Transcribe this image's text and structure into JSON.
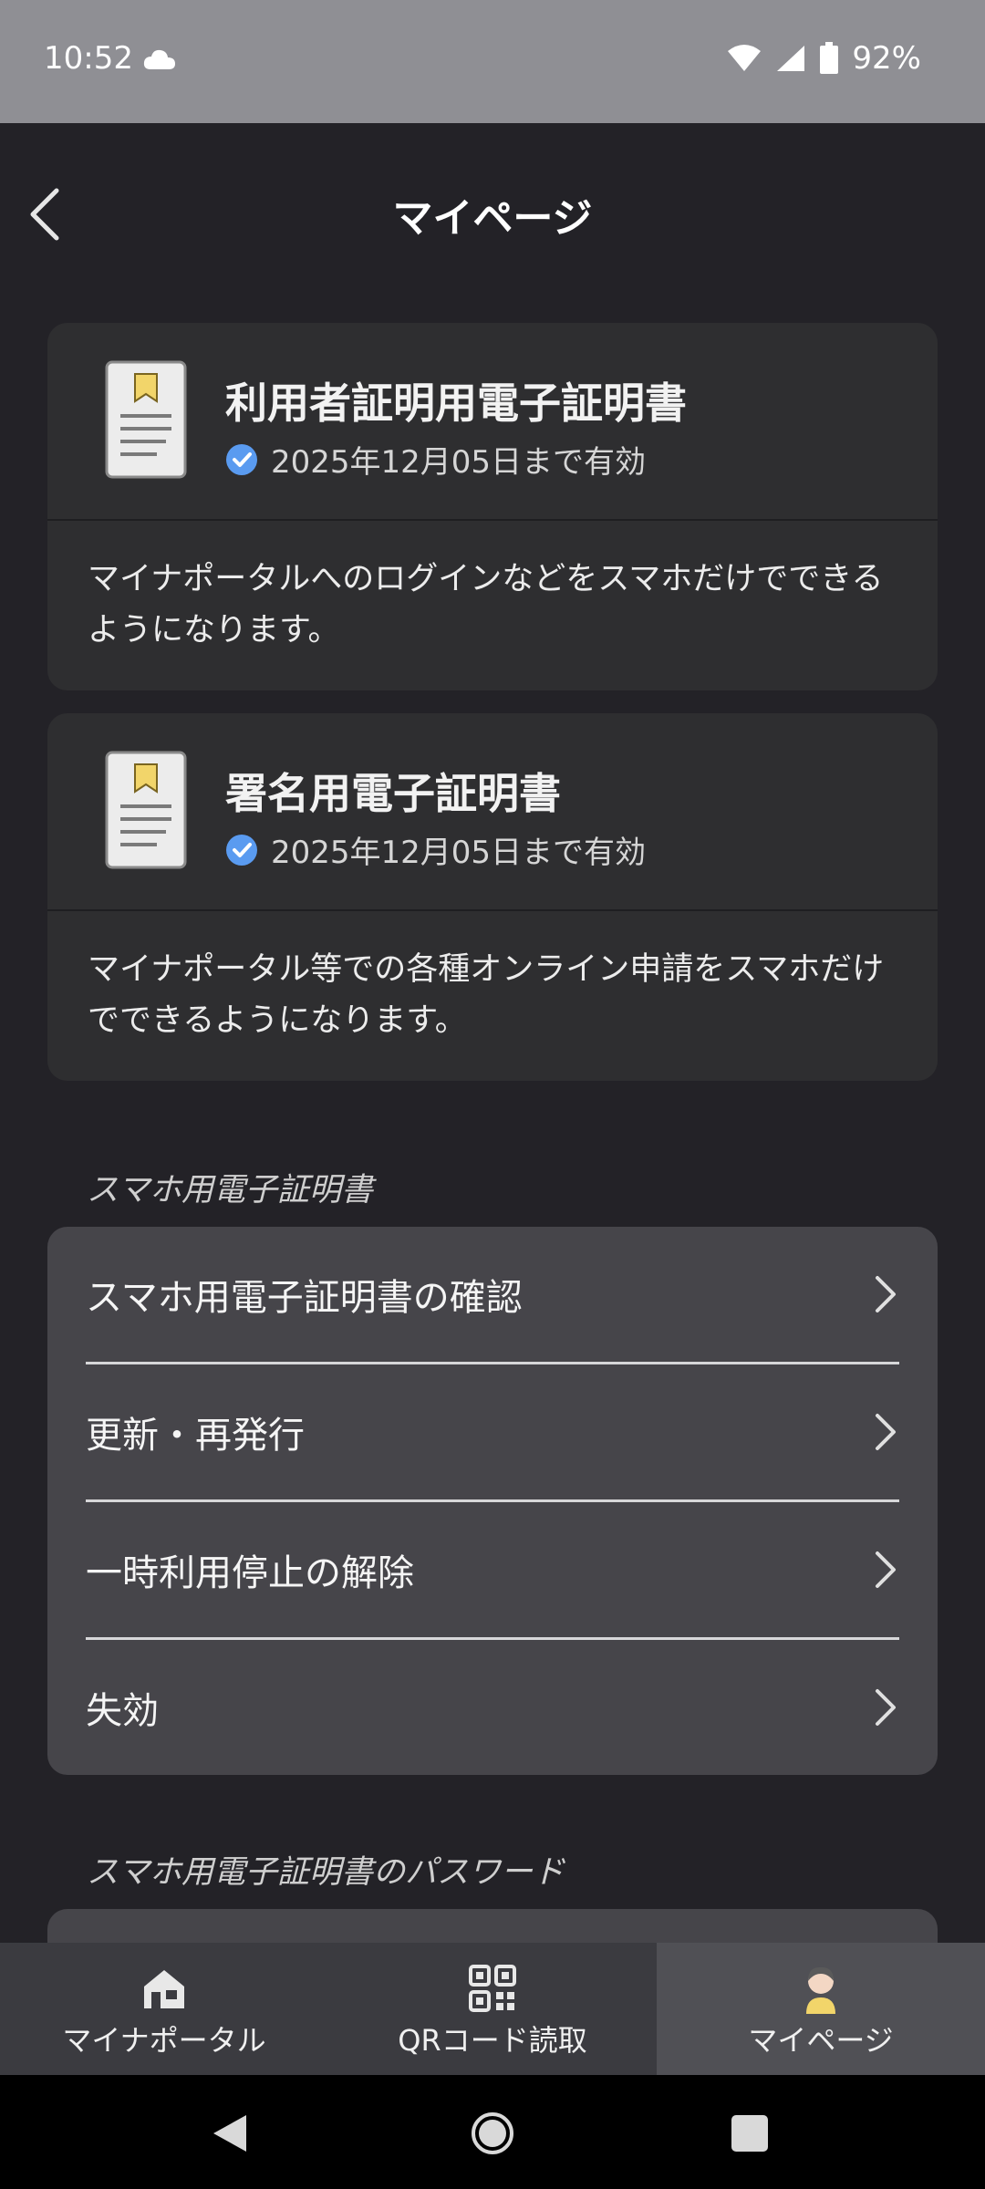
{
  "status_bar": {
    "time": "10:52",
    "battery": "92%"
  },
  "header": {
    "title": "マイページ"
  },
  "certificates": [
    {
      "title": "利用者証明用電子証明書",
      "validity": "2025年12月05日まで有効",
      "description": "マイナポータルへのログインなどをスマホだけでできるようになります。"
    },
    {
      "title": "署名用電子証明書",
      "validity": "2025年12月05日まで有効",
      "description": "マイナポータル等での各種オンライン申請をスマホだけでできるようになります。"
    }
  ],
  "sections": {
    "certificate": {
      "label": "スマホ用電子証明書",
      "items": [
        "スマホ用電子証明書の確認",
        "更新・再発行",
        "一時利用停止の解除",
        "失効"
      ]
    },
    "password": {
      "label": "スマホ用電子証明書のパスワード"
    }
  },
  "bottom_nav": {
    "items": [
      {
        "label": "マイナポータル",
        "icon": "house-icon"
      },
      {
        "label": "QRコード読取",
        "icon": "qr-code-icon"
      },
      {
        "label": "マイページ",
        "icon": "user-avatar-icon"
      }
    ],
    "active_index": 2
  },
  "colors": {
    "accent_check": "#5a9bf0",
    "active_tab": "#505055"
  }
}
